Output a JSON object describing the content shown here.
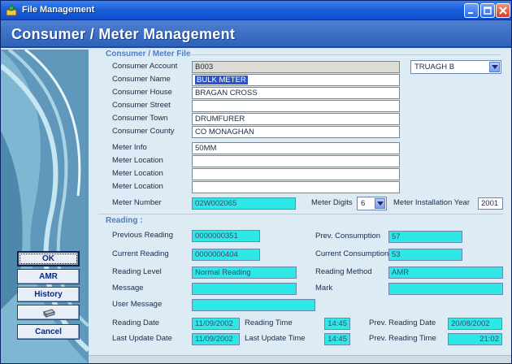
{
  "window": {
    "title": "File Management"
  },
  "header": {
    "heading": "Consumer / Meter Management"
  },
  "sidebar": {
    "ok": "OK",
    "amr": "AMR",
    "history": "History",
    "cancel": "Cancel"
  },
  "consumer": {
    "section_title": "Consumer / Meter File",
    "account_label": "Consumer Account",
    "account_value": "B003",
    "area_value": "TRUAGH B",
    "name_label": "Consumer Name",
    "name_value": "BULK METER",
    "house_label": "Consumer House",
    "house_value": "BRAGAN CROSS",
    "street_label": "Consumer Street",
    "street_value": "",
    "town_label": "Consumer Town",
    "town_value": "DRUMFURER",
    "county_label": "Consumer County",
    "county_value": "CO MONAGHAN",
    "meter_info_label": "Meter Info",
    "meter_info_value": "50MM",
    "meter_location_label": "Meter Location",
    "meter_location_values": [
      "",
      "",
      ""
    ],
    "meter_number_label": "Meter Number",
    "meter_number_value": "02W002065",
    "meter_digits_label": "Meter Digits",
    "meter_digits_value": "6",
    "install_year_label": "Meter Installation Year",
    "install_year_value": "2001"
  },
  "reading": {
    "section_title": "Reading :",
    "previous_label": "Previous Reading",
    "previous_value": "0000000351",
    "prev_consumption_label": "Prev. Consumption",
    "prev_consumption_value": "57",
    "current_label": "Current Reading",
    "current_value": "0000000404",
    "current_consumption_label": "Current Consumption",
    "current_consumption_value": "53",
    "level_label": "Reading Level",
    "level_value": "Normal Reading",
    "method_label": "Reading Method",
    "method_value": "AMR",
    "message_label": "Message",
    "message_value": "",
    "mark_label": "Mark",
    "mark_value": "",
    "user_message_label": "User Message",
    "user_message_value": "",
    "date_label": "Reading Date",
    "date_value": "11/09/2002",
    "time_label": "Reading Time",
    "time_value": "14:45",
    "prev_date_label": "Prev. Reading Date",
    "prev_date_value": "20/08/2002",
    "last_update_date_label": "Last Update Date",
    "last_update_date_value": "11/09/2002",
    "last_update_time_label": "Last Update Time",
    "last_update_time_value": "14:45",
    "prev_time_label": "Prev. Reading Time",
    "prev_time_value": "21:02"
  }
}
